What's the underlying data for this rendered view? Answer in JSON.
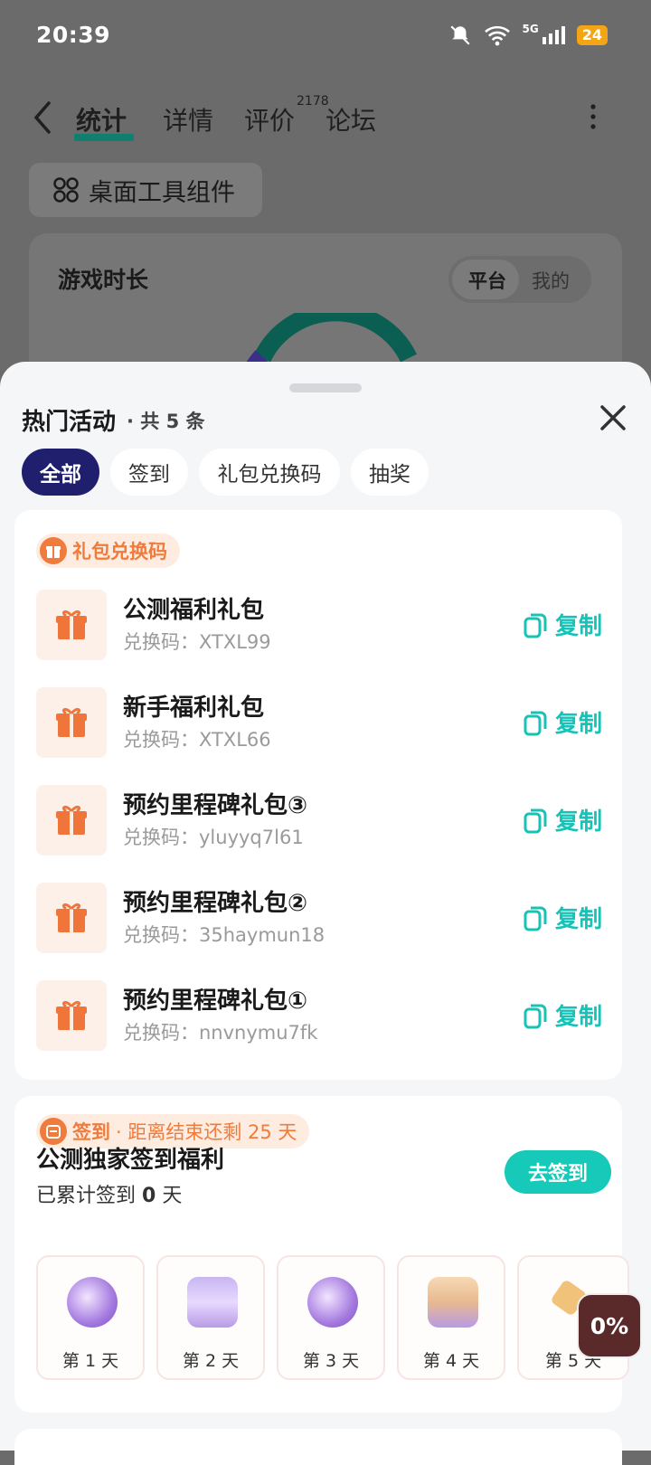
{
  "status_bar": {
    "time": "20:39",
    "network": "5G",
    "battery": "24"
  },
  "top_nav": {
    "tabs": [
      {
        "label": "统计",
        "active": true
      },
      {
        "label": "详情"
      },
      {
        "label": "评价",
        "badge": "2178"
      },
      {
        "label": "论坛"
      }
    ]
  },
  "widget_button": {
    "label": "桌面工具组件"
  },
  "play_card": {
    "title": "游戏时长",
    "segments": [
      "平台",
      "我的"
    ],
    "selected": "平台"
  },
  "sheet": {
    "title": "热门活动",
    "count": "· 共 5 条",
    "filters": [
      {
        "label": "全部",
        "active": true
      },
      {
        "label": "签到"
      },
      {
        "label": "礼包兑换码"
      },
      {
        "label": "抽奖"
      }
    ]
  },
  "gift_section": {
    "tag": "礼包兑换码",
    "code_prefix": "兑换码：",
    "copy_label": "复制",
    "items": [
      {
        "name": "公测福利礼包",
        "code": "XTXL99"
      },
      {
        "name": "新手福利礼包",
        "code": "XTXL66"
      },
      {
        "name": "预约里程碑礼包③",
        "code": "yluyyq7l61"
      },
      {
        "name": "预约里程碑礼包②",
        "code": "35haymun18"
      },
      {
        "name": "预约里程碑礼包①",
        "code": "nnvnymu7fk"
      }
    ]
  },
  "checkin_section": {
    "tag": "签到",
    "tag_extra": "· 距离结束还剩 25 天",
    "title": "公测独家签到福利",
    "progress_prefix": "已累计签到",
    "progress_days": "0",
    "progress_suffix": "天",
    "button": "去签到",
    "days": [
      "第 1 天",
      "第 2 天",
      "第 3 天",
      "第 4 天",
      "第 5 天"
    ]
  },
  "floating_badge": {
    "value": "0%"
  },
  "colors": {
    "accent": "#17c2b6",
    "orange": "#ef7b3c",
    "chip_active": "#1f1f6e"
  }
}
